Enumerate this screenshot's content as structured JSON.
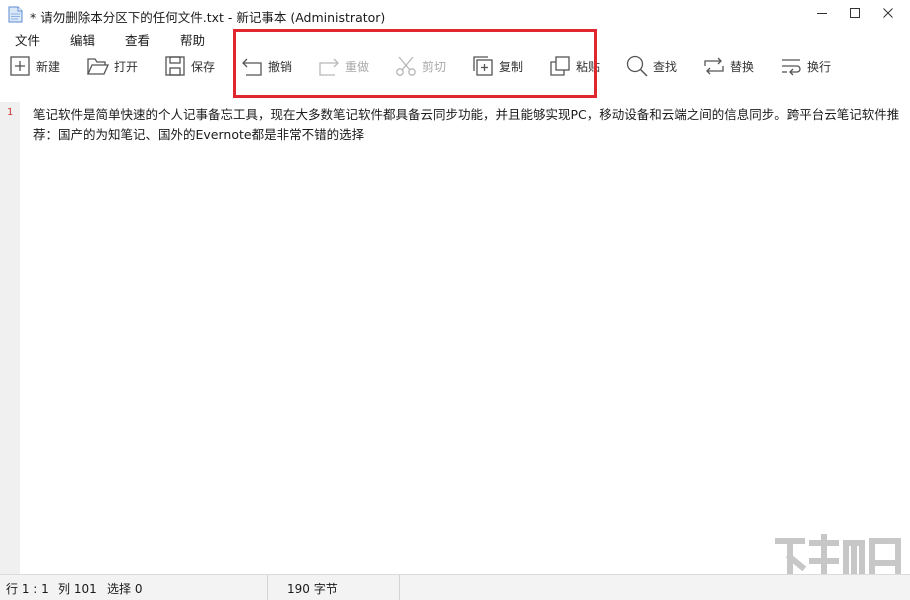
{
  "window": {
    "title": "* 请勿删除本分区下的任何文件.txt - 新记事本 (Administrator)",
    "icon": "notepad-icon"
  },
  "menu": [
    "文件",
    "编辑",
    "查看",
    "帮助"
  ],
  "toolbar": [
    {
      "label": "新建",
      "icon": "new-file-icon",
      "enabled": true
    },
    {
      "label": "打开",
      "icon": "open-folder-icon",
      "enabled": true
    },
    {
      "label": "保存",
      "icon": "save-icon",
      "enabled": true
    },
    {
      "label": "撤销",
      "icon": "undo-icon",
      "enabled": true
    },
    {
      "label": "重做",
      "icon": "redo-icon",
      "enabled": false
    },
    {
      "label": "剪切",
      "icon": "cut-icon",
      "enabled": false
    },
    {
      "label": "复制",
      "icon": "copy-icon",
      "enabled": true
    },
    {
      "label": "粘贴",
      "icon": "paste-icon",
      "enabled": true
    },
    {
      "label": "查找",
      "icon": "find-icon",
      "enabled": true
    },
    {
      "label": "替换",
      "icon": "replace-icon",
      "enabled": true
    },
    {
      "label": "换行",
      "icon": "wrap-icon",
      "enabled": true
    }
  ],
  "editor": {
    "line_number": "1",
    "content": "笔记软件是简单快速的个人记事备忘工具，现在大多数笔记软件都具备云同步功能，并且能够实现PC，移动设备和云端之间的信息同步。跨平台云笔记软件推荐：国产的为知笔记、国外的Evernote都是非常不错的选择"
  },
  "status": {
    "row": "行 1 : 1",
    "col": "列 101",
    "selection": "选择 0",
    "size": "190 字节"
  },
  "colors": {
    "highlight": "#e0272f",
    "line_number": "#cc3333",
    "disabled_text": "#a8a8a8"
  }
}
